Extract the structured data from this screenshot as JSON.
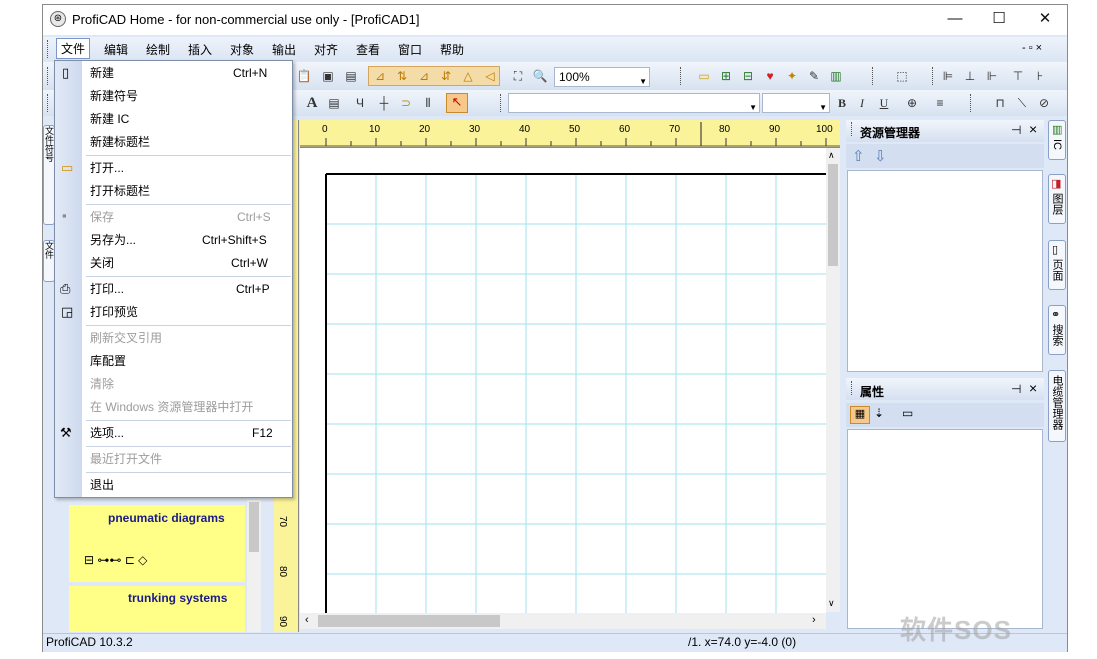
{
  "window": {
    "title": "ProfiCAD Home - for non-commercial use only - [ProfiCAD1]",
    "minimize_glyph": "—",
    "maximize_glyph": "☐",
    "close_glyph": "✕",
    "mdi_controls": "- ▫ ×"
  },
  "menubar": {
    "items": [
      "文件",
      "编辑",
      "绘制",
      "插入",
      "对象",
      "输出",
      "对齐",
      "查看",
      "窗口",
      "帮助"
    ]
  },
  "toolbar": {
    "zoom_value": "100%"
  },
  "ruler": {
    "h_ticks": [
      "0",
      "10",
      "20",
      "30",
      "40",
      "50",
      "60",
      "70",
      "80",
      "90",
      "100"
    ],
    "v_ticks": [
      "70",
      "80",
      "90"
    ]
  },
  "file_menu": {
    "items": [
      {
        "label": "新建",
        "shortcut": "Ctrl+N"
      },
      {
        "label": "新建符号",
        "shortcut": ""
      },
      {
        "label": "新建 IC",
        "shortcut": ""
      },
      {
        "label": "新建标题栏",
        "shortcut": ""
      },
      {
        "label": "打开...",
        "shortcut": ""
      },
      {
        "label": "打开标题栏",
        "shortcut": ""
      },
      {
        "label": "保存",
        "shortcut": "Ctrl+S"
      },
      {
        "label": "另存为...",
        "shortcut": "Ctrl+Shift+S"
      },
      {
        "label": "关闭",
        "shortcut": "Ctrl+W"
      },
      {
        "label": "打印...",
        "shortcut": "Ctrl+P"
      },
      {
        "label": "打印预览",
        "shortcut": ""
      },
      {
        "label": "刷新交叉引用",
        "shortcut": ""
      },
      {
        "label": "库配置",
        "shortcut": ""
      },
      {
        "label": "清除",
        "shortcut": ""
      },
      {
        "label": "在 Windows 资源管理器中打开",
        "shortcut": ""
      },
      {
        "label": "选项...",
        "shortcut": "F12"
      },
      {
        "label": "最近打开文件",
        "shortcut": ""
      },
      {
        "label": "退出",
        "shortcut": ""
      }
    ]
  },
  "library": {
    "block1_title": "pneumatic diagrams",
    "block2_title": "trunking systems",
    "side_tab1": "文件符号",
    "side_tab2": "文件"
  },
  "right_panels": {
    "resource_title": "资源管理器",
    "props_title": "属性",
    "pin_glyph": "⊣",
    "close_glyph": "×"
  },
  "right_tabs": [
    "IC",
    "图层",
    "页面",
    "搜索",
    "电缆管理器"
  ],
  "status": {
    "left": "ProfiCAD 10.3.2",
    "right": "/1.  x=74.0  y=-4.0 (0)"
  },
  "watermark": "软件SOS"
}
